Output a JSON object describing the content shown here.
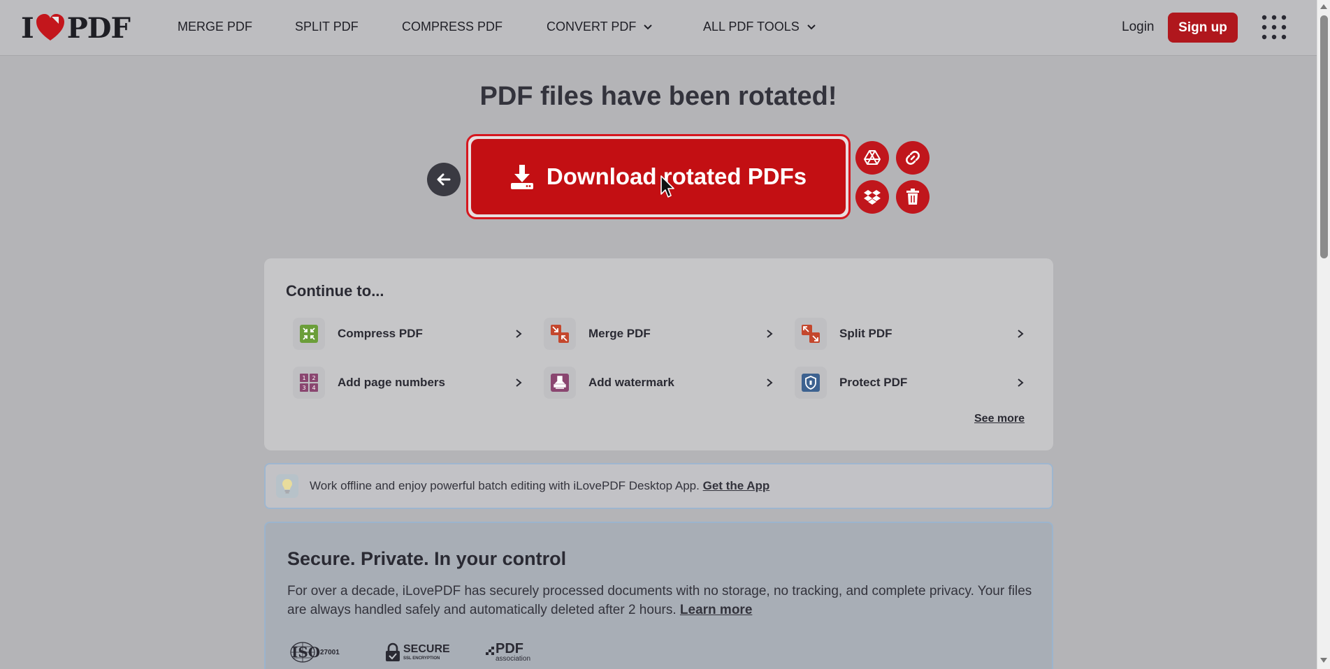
{
  "logo": {
    "left": "I",
    "right": "PDF"
  },
  "nav": {
    "merge": "MERGE PDF",
    "split": "SPLIT PDF",
    "compress": "COMPRESS PDF",
    "convert": "CONVERT PDF",
    "all_tools": "ALL PDF TOOLS"
  },
  "auth": {
    "login": "Login",
    "signup": "Sign up"
  },
  "main": {
    "title": "PDF files have been rotated!",
    "download_label": "Download rotated PDFs"
  },
  "continue": {
    "title": "Continue to...",
    "tools": [
      {
        "label": "Compress PDF",
        "icon": "compress-icon",
        "color": "#6b9e3a"
      },
      {
        "label": "Merge PDF",
        "icon": "merge-icon",
        "color": "#c4472d"
      },
      {
        "label": "Split PDF",
        "icon": "split-icon",
        "color": "#c4472d"
      },
      {
        "label": "Add page numbers",
        "icon": "page-numbers-icon",
        "color": "#8a4670"
      },
      {
        "label": "Add watermark",
        "icon": "watermark-icon",
        "color": "#8a4670"
      },
      {
        "label": "Protect PDF",
        "icon": "shield-icon",
        "color": "#3d6290"
      }
    ],
    "see_more": "See more"
  },
  "banner": {
    "text": "Work offline and enjoy powerful batch editing with iLovePDF Desktop App.",
    "link": "Get the App"
  },
  "secure": {
    "title": "Secure. Private. In your control",
    "text": "For over a decade, iLovePDF has securely processed documents with no storage, no tracking, and complete privacy. Your files are always handled safely and automatically deleted after 2 hours.",
    "link": "Learn more",
    "badges": {
      "iso": "ISO",
      "iso_num": "27001",
      "secure": "SECURE",
      "secure_sub": "SSL ENCRYPTION",
      "pdf": "PDF",
      "pdf_sub": "association"
    }
  },
  "colors": {
    "brand_red": "#c30f13",
    "dark": "#2a2a33"
  }
}
